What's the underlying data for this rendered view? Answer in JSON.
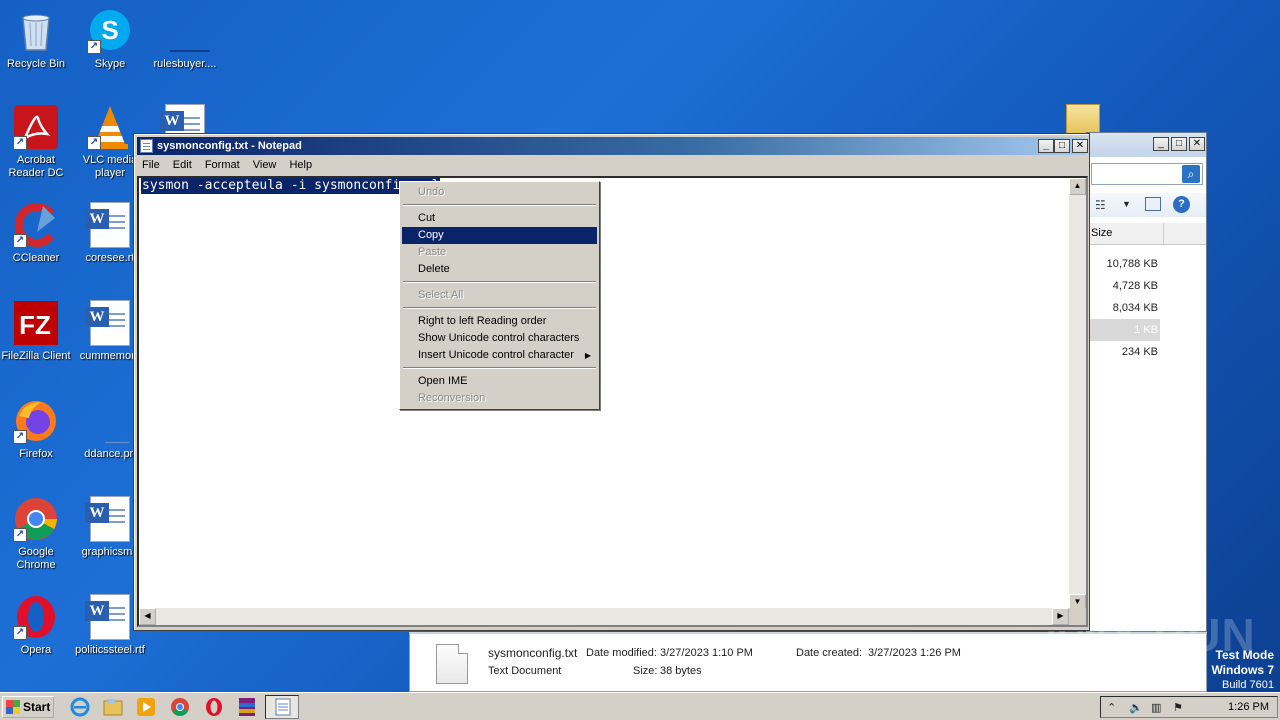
{
  "desktop": {
    "icons": [
      {
        "label": "Recycle Bin"
      },
      {
        "label": "Skype"
      },
      {
        "label": "rulesbuyer...."
      },
      {
        "label": "Acrobat Reader DC"
      },
      {
        "label": "VLC media player"
      },
      {
        "label": "CCleaner"
      },
      {
        "label": "coresee.rt"
      },
      {
        "label": "FileZilla Client"
      },
      {
        "label": "cummemory"
      },
      {
        "label": "Firefox"
      },
      {
        "label": "ddance.pn"
      },
      {
        "label": "Google Chrome"
      },
      {
        "label": "graphicsma"
      },
      {
        "label": "Opera"
      },
      {
        "label": "politicssteel.rtf"
      }
    ]
  },
  "notepad": {
    "title": "sysmonconfig.txt - Notepad",
    "menu": [
      "File",
      "Edit",
      "Format",
      "View",
      "Help"
    ],
    "content": "sysmon -accepteula -i sysmonconfig.xml"
  },
  "context_menu": {
    "items": [
      {
        "label": "Undo",
        "enabled": false
      },
      {
        "label": "Cut",
        "enabled": true
      },
      {
        "label": "Copy",
        "enabled": true,
        "highlighted": true
      },
      {
        "label": "Paste",
        "enabled": false
      },
      {
        "label": "Delete",
        "enabled": true
      },
      {
        "label": "Select All",
        "enabled": false
      },
      {
        "label": "Right to left Reading order",
        "enabled": true
      },
      {
        "label": "Show Unicode control characters",
        "enabled": true
      },
      {
        "label": "Insert Unicode control character",
        "enabled": true,
        "submenu": true
      },
      {
        "label": "Open IME",
        "enabled": true
      },
      {
        "label": "Reconversion",
        "enabled": false
      }
    ]
  },
  "explorer": {
    "column_header": "Size",
    "sizes": [
      "10,788 KB",
      "4,728 KB",
      "8,034 KB",
      "1 KB",
      "234 KB"
    ],
    "selected_index": 3
  },
  "details_pane": {
    "filename": "sysmonconfig.txt",
    "type": "Text Document",
    "modified_label": "Date modified:",
    "modified_value": "3/27/2023 1:10 PM",
    "created_label": "Date created:",
    "created_value": "3/27/2023 1:26 PM",
    "size_label": "Size:",
    "size_value": "38 bytes"
  },
  "taskbar": {
    "start_label": "Start",
    "clock": "1:26 PM"
  },
  "watermark": "ANY RUN",
  "test_mode": {
    "line1": "Test Mode",
    "line2": "Windows 7",
    "line3": "Build 7601"
  },
  "colors": {
    "desktop_bg": "#1a64cc",
    "selection": "#0a246a",
    "title_active": "#0a246a"
  }
}
